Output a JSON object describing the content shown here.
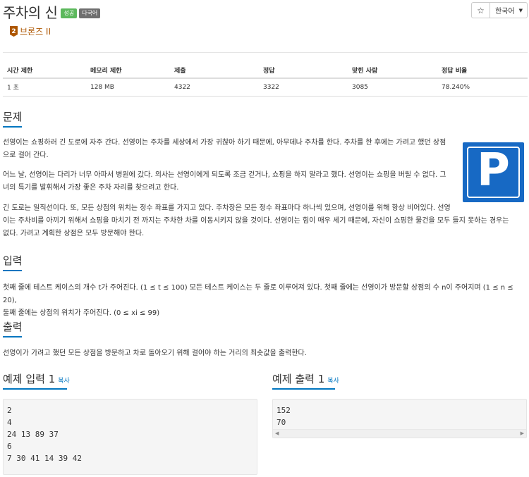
{
  "problem": {
    "title": "주차의 신",
    "badges": {
      "success": "성공",
      "multilang": "다국어"
    },
    "tier": {
      "num": "2",
      "text": "브론즈 II"
    }
  },
  "controls": {
    "star": "☆",
    "language": "한국어"
  },
  "info_table": {
    "headers": [
      "시간 제한",
      "메모리 제한",
      "제출",
      "정답",
      "맞힌 사람",
      "정답 비율"
    ],
    "values": [
      "1 초",
      "128 MB",
      "4322",
      "3322",
      "3085",
      "78.240%"
    ]
  },
  "sections": {
    "problem": {
      "title": "문제",
      "p1_line1": "선영이는 쇼핑하러 긴 도로에 자주 간다. 선영이는 주차를 세상에서 가장 귀찮아 하기 때문에, 아무데나 주차를 한다. 주차를 한 후에는 가려고 했던 상점",
      "p1_line2": "으로 걸어 간다.",
      "p2_line1": "어느 날, 선영이는 다리가 너무 아파서 병원에 갔다. 의사는 선영이에게 되도록 조금 걷거나, 쇼핑을 하지 말라고 했다. 선영이는 쇼핑을 버릴 수 없다. 그",
      "p2_line2": "녀의 특기를 발휘해서 가장 좋은 주차 자리를 찾으려고 한다.",
      "p3_line1": "긴 도로는 일직선이다. 또, 모든 상점의 위치는 정수 좌표를 가지고 있다. 주차장은 모든 정수 좌표마다 하나씩 있으며, 선영이를 위해 항상 비어있다. 선영",
      "p3_line2": "이는 주차비를 아끼기 위해서 쇼핑을 마치기 전 까지는 주차한 차를 이동시키지 않을 것이다. 선영이는 힘이 매우 세기 때문에, 자신이 쇼핑한 물건을 모두 들지 못하는 경우는",
      "p3_line3": "없다. 가려고 계획한 상점은 모두 방문해야 한다.",
      "image_letter": "P"
    },
    "input": {
      "title": "입력",
      "line1": "첫째 줄에 테스트 케이스의 개수 t가 주어진다. (1 ≤ t ≤ 100) 모든 테스트 케이스는 두 줄로 이루어져 있다. 첫째 줄에는 선영이가 방문할 상점의 수 n이 주어지며 (1 ≤ n ≤ 20),",
      "line2": "둘째 줄에는 상점의 위치가 주어진다. (0 ≤ xi ≤ 99)"
    },
    "output": {
      "title": "출력",
      "line1": "선영이가 가려고 했던 모든 상점을 방문하고 차로 돌아오기 위해 걸어야 하는 거리의 최솟값을 출력한다."
    }
  },
  "samples": {
    "input": {
      "title": "예제 입력 1",
      "copy": "복사",
      "text": "2\n4\n24 13 89 37\n6\n7 30 41 14 39 42"
    },
    "output": {
      "title": "예제 출력 1",
      "copy": "복사",
      "text": "152\n70"
    }
  },
  "colors": {
    "accent": "#0076c0",
    "bronze": "#ad5600",
    "success": "#5cb85c",
    "parking_blue": "#1769c4"
  }
}
